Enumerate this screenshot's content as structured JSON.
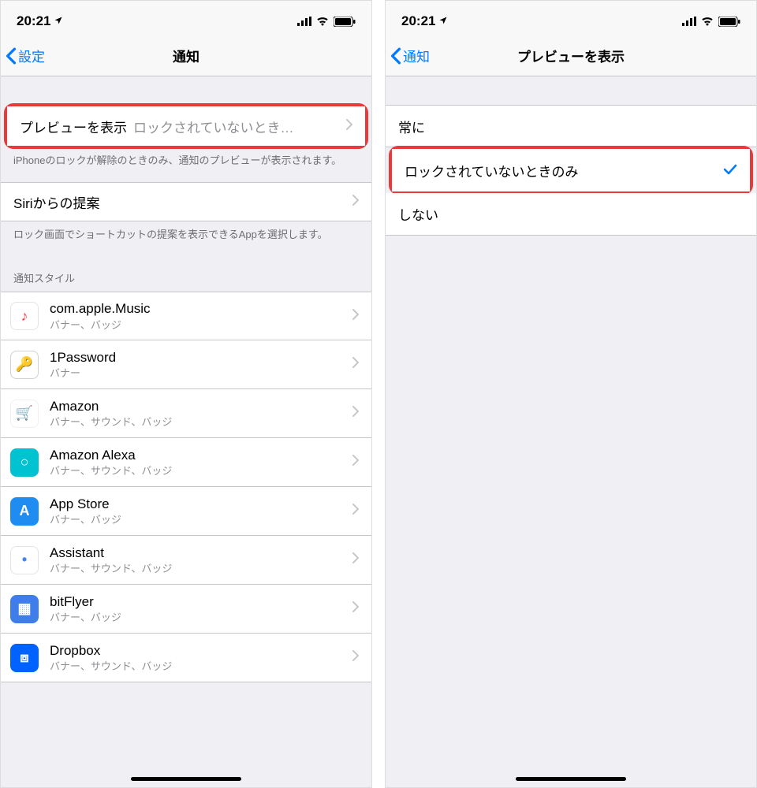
{
  "status": {
    "time": "20:21",
    "location_arrow": "➤"
  },
  "left": {
    "back_label": "設定",
    "title": "通知",
    "preview": {
      "label": "プレビューを表示",
      "value": "ロックされていないとき…"
    },
    "preview_footer": "iPhoneのロックが解除のときのみ、通知のプレビューが表示されます。",
    "siri": {
      "label": "Siriからの提案"
    },
    "siri_footer": "ロック画面でショートカットの提案を表示できるAppを選択します。",
    "style_header": "通知スタイル",
    "apps": [
      {
        "name": "com.apple.Music",
        "detail": "バナー、バッジ",
        "bg": "#ffffff",
        "border": "#e3e3e3",
        "glyph": "♪",
        "glyph_color": "#fc3c44"
      },
      {
        "name": "1Password",
        "detail": "バナー",
        "bg": "#ffffff",
        "border": "#d0d0d0",
        "glyph": "🔑",
        "glyph_color": "#3b6fb5"
      },
      {
        "name": "Amazon",
        "detail": "バナー、サウンド、バッジ",
        "bg": "#ffffff",
        "border": "#f0f0f0",
        "glyph": "🛒",
        "glyph_color": "#1ca6d4"
      },
      {
        "name": "Amazon Alexa",
        "detail": "バナー、サウンド、バッジ",
        "bg": "#00c2d1",
        "border": "#00c2d1",
        "glyph": "○",
        "glyph_color": "#ffffff"
      },
      {
        "name": "App Store",
        "detail": "バナー、バッジ",
        "bg": "#1f8cf2",
        "border": "#1f8cf2",
        "glyph": "A",
        "glyph_color": "#ffffff"
      },
      {
        "name": "Assistant",
        "detail": "バナー、サウンド、バッジ",
        "bg": "#ffffff",
        "border": "#e3e3e3",
        "glyph": "•",
        "glyph_color": "#4285f4"
      },
      {
        "name": "bitFlyer",
        "detail": "バナー、バッジ",
        "bg": "#3f7eea",
        "border": "#3f7eea",
        "glyph": "▦",
        "glyph_color": "#ffffff"
      },
      {
        "name": "Dropbox",
        "detail": "バナー、サウンド、バッジ",
        "bg": "#0062ff",
        "border": "#0062ff",
        "glyph": "⧈",
        "glyph_color": "#ffffff"
      }
    ]
  },
  "right": {
    "back_label": "通知",
    "title": "プレビューを表示",
    "options": [
      {
        "label": "常に",
        "checked": false
      },
      {
        "label": "ロックされていないときのみ",
        "checked": true
      },
      {
        "label": "しない",
        "checked": false
      }
    ]
  }
}
